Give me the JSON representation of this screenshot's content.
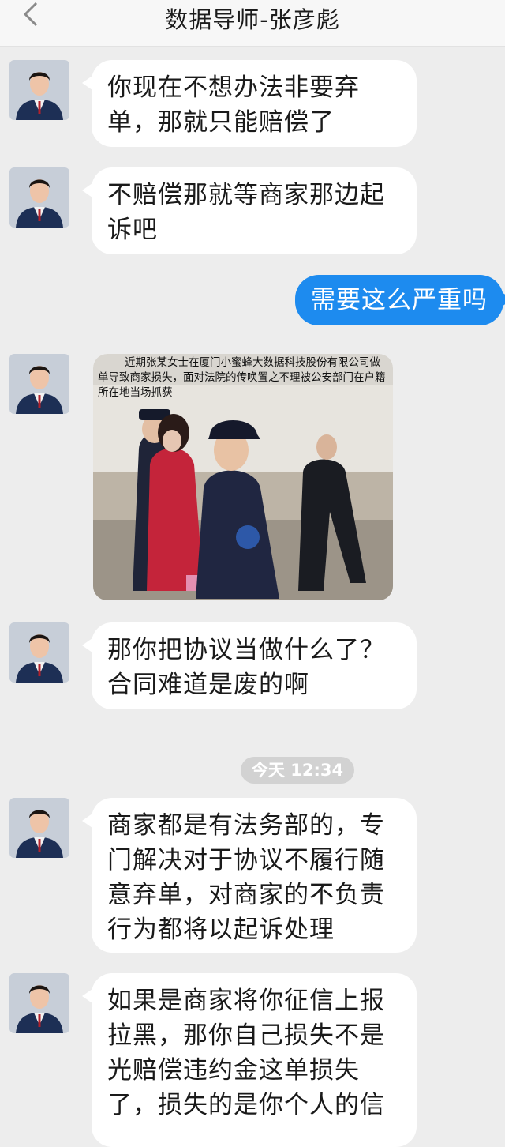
{
  "header": {
    "title": "数据导师-张彦彪"
  },
  "messages": {
    "m1": {
      "lines": [
        "你现在不想办法非要弃",
        "单，那就只能赔偿了"
      ]
    },
    "m2": {
      "lines": [
        "不赔偿那就等商家那边起",
        "诉吧"
      ]
    },
    "m3": {
      "text": "需要这么严重吗"
    },
    "m4": {
      "caption": "近期张某女士在厦门小蜜蜂大数据科技股份有限公司做单导致商家损失，面对法院的传唤置之不理被公安部门在户籍所在地当场抓获"
    },
    "m5": {
      "lines": [
        "那你把协议当做什么了？",
        "合同难道是废的啊"
      ]
    },
    "m6": {
      "lines": [
        "商家都是有法务部的，专",
        "门解决对于协议不履行随",
        "意弃单，对商家的不负责",
        "行为都将以起诉处理"
      ]
    },
    "m7": {
      "lines": [
        "如果是商家将你征信上报",
        "拉黑，那你自己损失不是",
        "光赔偿违约金这单损失",
        "了，损失的是你个人的信"
      ]
    }
  },
  "timestamp": "今天 12:34",
  "colors": {
    "accent": "#1d8bef",
    "background": "#ededed",
    "bubble": "#ffffff"
  },
  "icons": {
    "back": "chevron-left-icon",
    "avatar": "user-avatar"
  }
}
